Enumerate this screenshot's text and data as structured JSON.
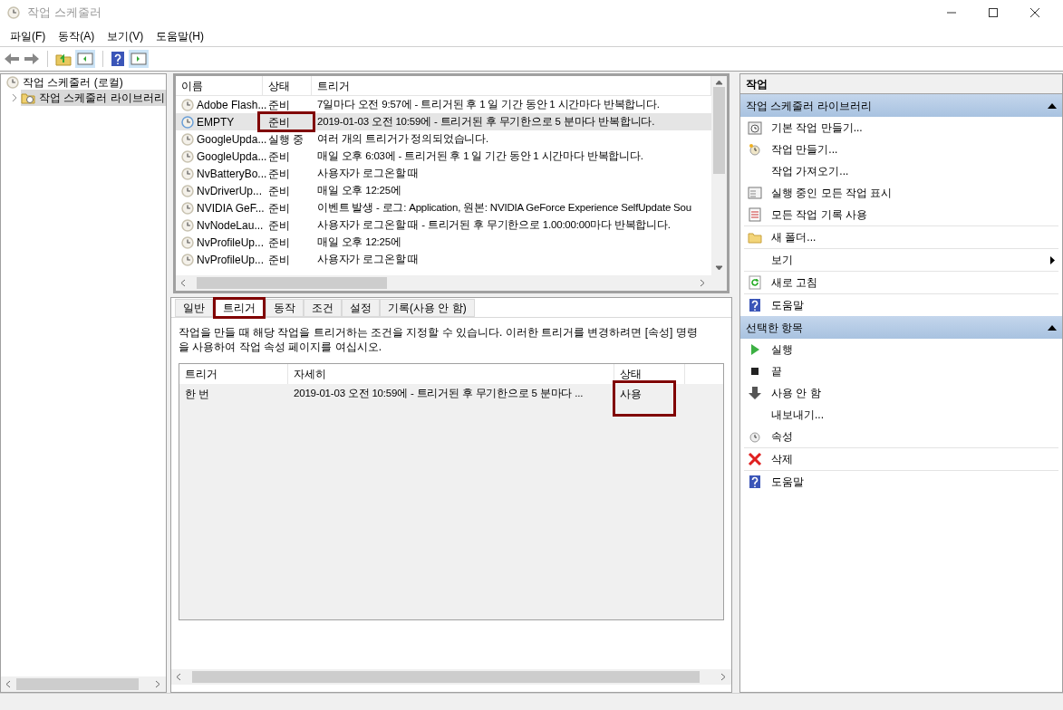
{
  "window": {
    "title": "작업 스케줄러"
  },
  "menu": [
    "파일(F)",
    "동작(A)",
    "보기(V)",
    "도움말(H)"
  ],
  "tree": [
    {
      "label": "작업 스케줄러 (로컬)",
      "selected": false,
      "expanded": true,
      "children": [
        {
          "label": "작업 스케줄러 라이브러리",
          "selected": true,
          "expanded": false
        }
      ]
    }
  ],
  "task_list": {
    "columns": [
      "이름",
      "상태",
      "트리거"
    ],
    "rows": [
      {
        "name": "Adobe Flash...",
        "status": "준비",
        "trigger": "7일마다 오전 9:57에 - 트리거된 후 1 일 기간 동안 1 시간마다 반복합니다.",
        "selected": false
      },
      {
        "name": "EMPTY",
        "status": "준비",
        "trigger": "2019-01-03 오전 10:59에 - 트리거된 후 무기한으로 5 분마다 반복합니다.",
        "selected": true
      },
      {
        "name": "GoogleUpda...",
        "status": "실행 중",
        "trigger": "여러 개의 트리거가 정의되었습니다.",
        "selected": false
      },
      {
        "name": "GoogleUpda...",
        "status": "준비",
        "trigger": "매일 오후 6:03에 - 트리거된 후 1 일 기간 동안 1 시간마다 반복합니다.",
        "selected": false
      },
      {
        "name": "NvBatteryBo...",
        "status": "준비",
        "trigger": "사용자가 로그온할 때",
        "selected": false
      },
      {
        "name": "NvDriverUp...",
        "status": "준비",
        "trigger": "매일 오후 12:25에",
        "selected": false
      },
      {
        "name": "NVIDIA GeF...",
        "status": "준비",
        "trigger": "이벤트 발생 - 로그: Application, 원본: NVIDIA GeForce Experience SelfUpdate Sou",
        "selected": false
      },
      {
        "name": "NvNodeLau...",
        "status": "준비",
        "trigger": "사용자가 로그온할 때 - 트리거된 후 무기한으로 1.00:00:00마다 반복합니다.",
        "selected": false
      },
      {
        "name": "NvProfileUp...",
        "status": "준비",
        "trigger": "매일 오후 12:25에",
        "selected": false
      },
      {
        "name": "NvProfileUp...",
        "status": "준비",
        "trigger": "사용자가 로그온할 때",
        "selected": false
      }
    ]
  },
  "tabs": [
    {
      "label": "일반",
      "selected": false
    },
    {
      "label": "트리거",
      "selected": true
    },
    {
      "label": "동작",
      "selected": false
    },
    {
      "label": "조건",
      "selected": false
    },
    {
      "label": "설정",
      "selected": false
    },
    {
      "label": "기록(사용 안 함)",
      "selected": false
    }
  ],
  "trigger_tab": {
    "description": "작업을 만들 때 해당 작업을 트리거하는 조건을 지정할 수 있습니다. 이러한 트리거를 변경하려면 [속성] 명령을 사용하여 작업 속성 페이지를 여십시오.",
    "columns": [
      "트리거",
      "자세히",
      "상태"
    ],
    "rows": [
      {
        "trigger": "한 번",
        "details": "2019-01-03 오전 10:59에 - 트리거된 후 무기한으로 5 분마다 ...",
        "status": "사용",
        "selected": true
      }
    ]
  },
  "actions": {
    "title": "작업",
    "sections": [
      {
        "title": "작업 스케줄러 라이브러리",
        "expanded": true,
        "groups": [
          [
            {
              "label": "기본 작업 만들기...",
              "kind": "action"
            },
            {
              "label": "작업 만들기...",
              "kind": "action"
            },
            {
              "label": "작업 가져오기...",
              "kind": "action"
            },
            {
              "label": "실행 중인 모든 작업 표시",
              "kind": "action"
            },
            {
              "label": "모든 작업 기록 사용",
              "kind": "action"
            }
          ],
          [
            {
              "label": "새 폴더...",
              "kind": "action"
            }
          ],
          [
            {
              "label": "보기",
              "kind": "submenu"
            }
          ],
          [
            {
              "label": "새로 고침",
              "kind": "action"
            }
          ],
          [
            {
              "label": "도움말",
              "kind": "action"
            }
          ]
        ]
      },
      {
        "title": "선택한 항목",
        "expanded": true,
        "groups": [
          [
            {
              "label": "실행",
              "kind": "action"
            },
            {
              "label": "끝",
              "kind": "action"
            },
            {
              "label": "사용 안 함",
              "kind": "action"
            },
            {
              "label": "내보내기...",
              "kind": "action"
            },
            {
              "label": "속성",
              "kind": "action"
            }
          ],
          [
            {
              "label": "삭제",
              "kind": "action"
            }
          ],
          [
            {
              "label": "도움말",
              "kind": "action"
            }
          ]
        ]
      }
    ]
  }
}
